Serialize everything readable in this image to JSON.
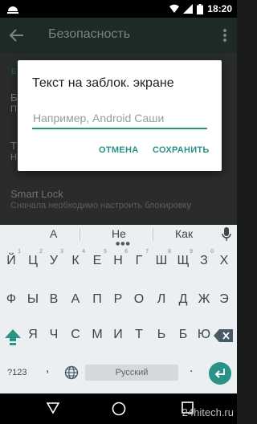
{
  "status_bar": {
    "time": "18:20"
  },
  "toolbar": {
    "title": "Безопасность"
  },
  "background_settings": {
    "category_fragment": "Б",
    "row1_fragment": "Б",
    "row1_sub_fragment": "П",
    "row2_fragment": "Т",
    "row2_sub_fragment": "Н",
    "smart_lock_title": "Smart Lock",
    "smart_lock_subtitle": "Сначала необходимо настроить блокировку"
  },
  "dialog": {
    "title": "Текст на заблок. экране",
    "input_placeholder": "Например, Android Саши",
    "input_value": "",
    "cancel_label": "ОТМЕНА",
    "save_label": "СОХРАНИТЬ"
  },
  "keyboard": {
    "suggestions": [
      "А",
      "Не",
      "Как"
    ],
    "row1": [
      "Й",
      "Ц",
      "У",
      "К",
      "Е",
      "Н",
      "Г",
      "Ш",
      "Щ",
      "З",
      "Х"
    ],
    "row1_hints": [
      "1",
      "2",
      "3",
      "4",
      "5",
      "6",
      "7",
      "8",
      "9",
      "0",
      ""
    ],
    "row2": [
      "Ф",
      "Ы",
      "В",
      "А",
      "П",
      "Р",
      "О",
      "Л",
      "Д",
      "Ж",
      "Э"
    ],
    "row3": [
      "Я",
      "Ч",
      "С",
      "М",
      "И",
      "Т",
      "Ь",
      "Б",
      "Ю"
    ],
    "symbols_label": "?123",
    "comma": ",",
    "space_label": "Русский",
    "period": ".",
    "accent_color": "#2a9287"
  },
  "watermark": "24hitech.ru"
}
